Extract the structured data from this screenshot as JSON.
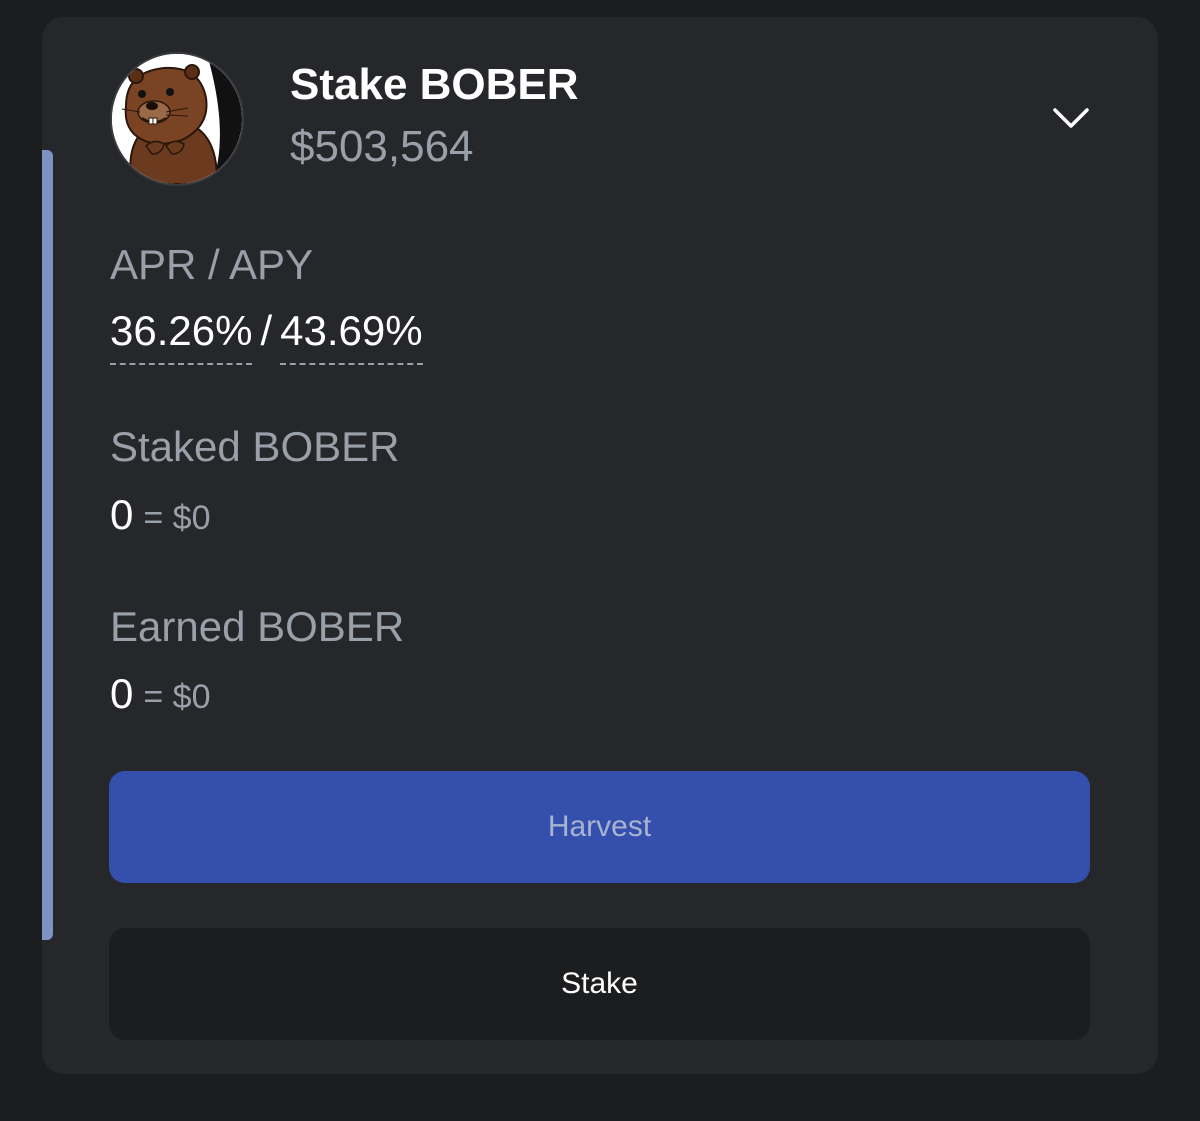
{
  "pool": {
    "title": "Stake BOBER",
    "tvl": "$503,564",
    "token_icon": "beaver-avatar",
    "expand_icon": "chevron-down-icon"
  },
  "rates": {
    "label": "APR / APY",
    "apr": "36.26%",
    "separator": "/",
    "apy": "43.69%"
  },
  "staked": {
    "label": "Staked BOBER",
    "amount": "0",
    "usd": "= $0"
  },
  "earned": {
    "label": "Earned BOBER",
    "amount": "0",
    "usd": "= $0"
  },
  "buttons": {
    "harvest": "Harvest",
    "stake": "Stake"
  },
  "colors": {
    "page_bg": "#1c1d1f",
    "card_bg": "#26272a",
    "accent": "#354fad",
    "side_bar": "#7e93c4",
    "muted_text": "#9aa0aa"
  }
}
